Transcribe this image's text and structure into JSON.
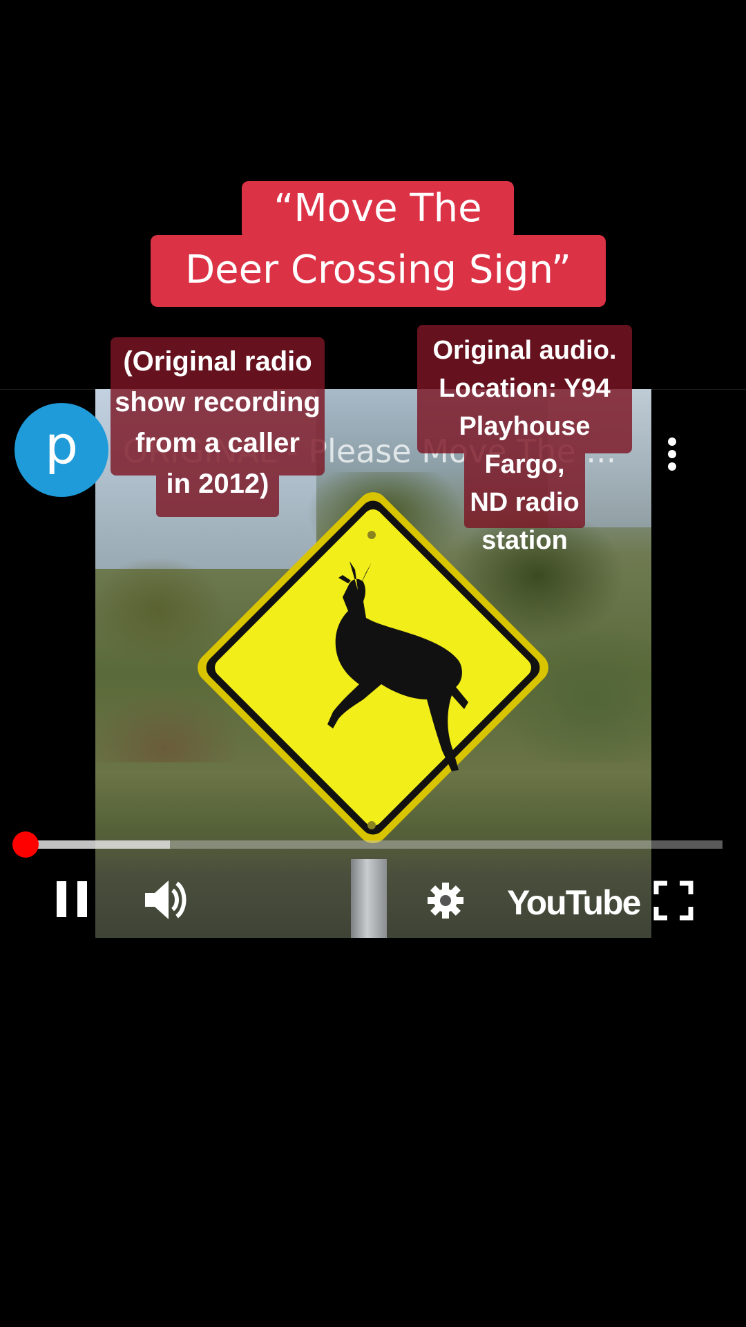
{
  "caption": {
    "line1": "“Move The",
    "line2": "Deer Crossing Sign”"
  },
  "notes": {
    "left": [
      "(Original radio",
      "show recording",
      "from a caller",
      "in 2012)"
    ],
    "right": [
      "Original audio.",
      "Location: Y94",
      "Playhouse Fargo,",
      "ND radio",
      "station"
    ]
  },
  "player": {
    "channel_initial": "p",
    "video_title": "ORIGINAL - Please Move The ...",
    "brand": "YouTube",
    "progress_fraction": 0.0,
    "buffered_fraction": 0.22
  },
  "icons": [
    "more-vert-icon",
    "pause-icon",
    "volume-icon",
    "settings-gear-icon",
    "fullscreen-icon",
    "deer-crossing-sign"
  ],
  "colors": {
    "caption_bg": "#dc3246",
    "note_bg": "#7d1624",
    "avatar_bg": "#1e9bd8",
    "progress_played": "#ff0000",
    "sign_yellow": "#f2ee1a"
  }
}
